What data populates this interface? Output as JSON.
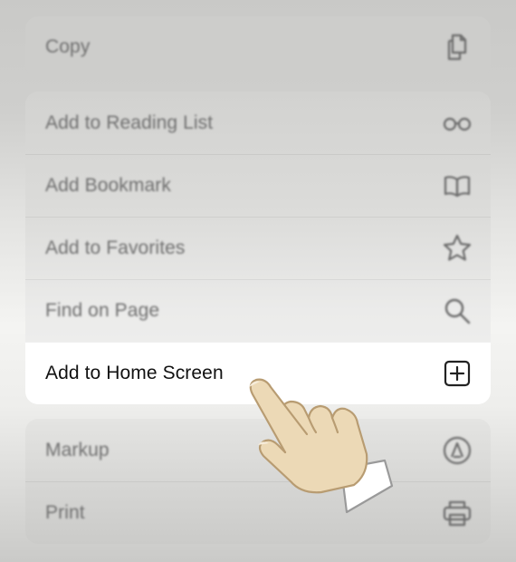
{
  "menu": {
    "copy_group": [
      {
        "label": "Copy",
        "icon": "copy-icon"
      }
    ],
    "main_group": [
      {
        "label": "Add to Reading List",
        "icon": "glasses-icon"
      },
      {
        "label": "Add Bookmark",
        "icon": "book-icon"
      },
      {
        "label": "Add to Favorites",
        "icon": "star-icon"
      },
      {
        "label": "Find on Page",
        "icon": "magnifier-icon"
      },
      {
        "label": "Add to Home Screen",
        "icon": "plus-square-icon",
        "highlighted": true
      }
    ],
    "bottom_group": [
      {
        "label": "Markup",
        "icon": "markup-icon"
      },
      {
        "label": "Print",
        "icon": "printer-icon"
      }
    ]
  },
  "overlay": {
    "pointer": "tapping-hand-icon"
  },
  "colors": {
    "highlight_bg": "#ffffff",
    "label_text": "#6f6f6f",
    "highlight_text": "#111111",
    "hand_skin": "#ecd9b6",
    "hand_outline": "#b89c72"
  }
}
